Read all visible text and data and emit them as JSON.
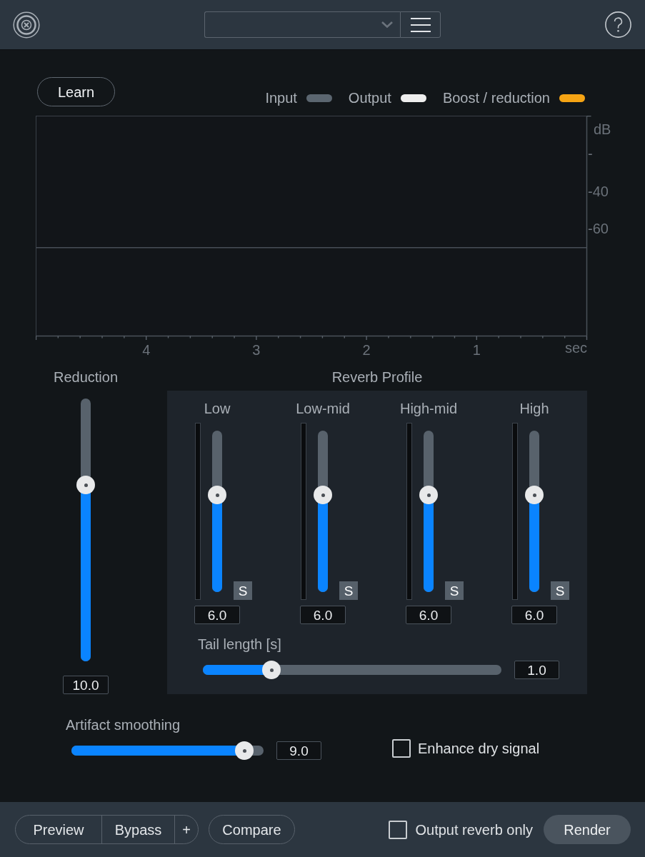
{
  "learn_button": {
    "label": "Learn"
  },
  "legend": [
    {
      "label": "Input",
      "color": "#5b6670"
    },
    {
      "label": "Output",
      "color": "#eeeeee"
    },
    {
      "label": "Boost / reduction",
      "color": "#f5a414"
    }
  ],
  "meter": {
    "chart_data": {
      "type": "line",
      "xlabel": "sec",
      "ylabel": "dB",
      "x": [
        5,
        0
      ],
      "series": [
        {
          "color": "#474e57",
          "values": [
            -70,
            -70
          ]
        }
      ],
      "xlim": [
        5,
        0
      ],
      "ylim": [
        -117,
        0
      ],
      "xticks": [
        4,
        3,
        2,
        1
      ],
      "yticks": [
        {
          "value": -20,
          "label": "-"
        },
        {
          "value": -40,
          "label": "-40"
        },
        {
          "value": -60,
          "label": "-60"
        }
      ]
    }
  },
  "reduction": {
    "label": "Reduction",
    "level": 0.67,
    "value": "10.0"
  },
  "reverb_profile": {
    "title": "Reverb Profile",
    "bands": [
      {
        "label": "Low",
        "level": 0.6,
        "value": "6.0",
        "solo": "S"
      },
      {
        "label": "Low-mid",
        "level": 0.6,
        "value": "6.0",
        "solo": "S"
      },
      {
        "label": "High-mid",
        "level": 0.6,
        "value": "6.0",
        "solo": "S"
      },
      {
        "label": "High",
        "level": 0.6,
        "value": "6.0",
        "solo": "S"
      }
    ],
    "tail_length": {
      "label": "Tail length [s]",
      "level": 0.23,
      "value": "1.0"
    }
  },
  "artifact_smoothing": {
    "label": "Artifact smoothing",
    "level": 0.9,
    "value": "9.0"
  },
  "enhance_dry_signal": {
    "label": "Enhance dry signal",
    "checked": false
  },
  "footer": {
    "transport": [
      {
        "label": "Preview"
      },
      {
        "label": "Bypass"
      },
      {
        "label": "+"
      }
    ],
    "compare": {
      "label": "Compare"
    },
    "output_reverb_only": {
      "label": "Output reverb only",
      "checked": false
    },
    "render": {
      "label": "Render"
    }
  }
}
